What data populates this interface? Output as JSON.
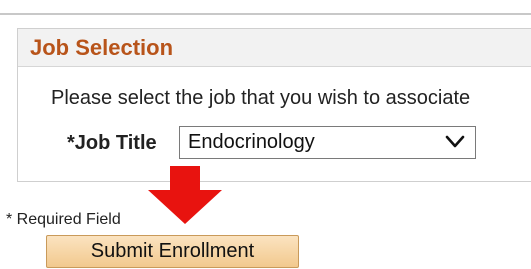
{
  "job_selection": {
    "title": "Job Selection",
    "instructions": "Please select the job that you wish to associate",
    "job_title_label": "*Job Title",
    "job_title_value": "Endocrinology"
  },
  "footer": {
    "required_note": "* Required Field",
    "submit_label": "Submit Enrollment"
  },
  "colors": {
    "title": "#b8541a",
    "arrow": "#e8130f",
    "button_fill": "#f2c98e"
  },
  "icons": {
    "dropdown": "chevron-down-icon",
    "pointer": "red-down-arrow"
  }
}
